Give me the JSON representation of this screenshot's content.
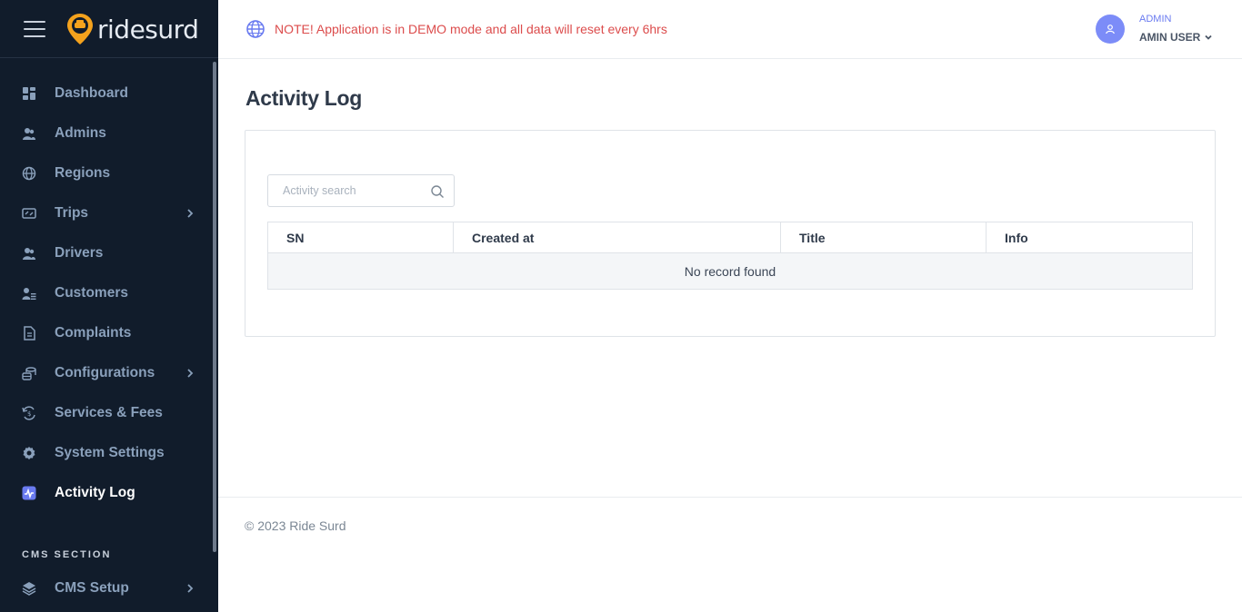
{
  "brand": {
    "name": "ridesurd",
    "accent": "#f4a21d"
  },
  "sidebar": {
    "items": [
      {
        "label": "Dashboard",
        "icon": "dashboard-icon",
        "has_submenu": false
      },
      {
        "label": "Admins",
        "icon": "users-icon",
        "has_submenu": false
      },
      {
        "label": "Regions",
        "icon": "globe-icon",
        "has_submenu": false
      },
      {
        "label": "Trips",
        "icon": "trips-icon",
        "has_submenu": true
      },
      {
        "label": "Drivers",
        "icon": "users-icon",
        "has_submenu": false
      },
      {
        "label": "Customers",
        "icon": "customers-icon",
        "has_submenu": false
      },
      {
        "label": "Complaints",
        "icon": "document-icon",
        "has_submenu": false
      },
      {
        "label": "Configurations",
        "icon": "coins-icon",
        "has_submenu": true
      },
      {
        "label": "Services & Fees",
        "icon": "services-icon",
        "has_submenu": false
      },
      {
        "label": "System Settings",
        "icon": "gear-icon",
        "has_submenu": false
      },
      {
        "label": "Activity Log",
        "icon": "activity-icon",
        "has_submenu": false,
        "active": true
      }
    ],
    "cms_section_title": "CMS SECTION",
    "cms_items": [
      {
        "label": "CMS Setup",
        "icon": "layers-icon",
        "has_submenu": true
      }
    ]
  },
  "header": {
    "notice": "NOTE! Application is in DEMO mode and all data will reset every 6hrs",
    "user_role": "ADMIN",
    "user_name": "AMIN USER"
  },
  "main": {
    "title": "Activity Log",
    "search_placeholder": "Activity search",
    "table": {
      "columns": [
        "SN",
        "Created at",
        "Title",
        "Info"
      ],
      "empty_message": "No record found"
    }
  },
  "footer": {
    "text": "© 2023 Ride Surd"
  },
  "colors": {
    "sidebar_bg": "#111c2b",
    "menu_text": "#8aa0bb",
    "notice_red": "#dc4c4c",
    "avatar_bg": "#7c8cf8",
    "active_icon": "#6a7bf0"
  }
}
